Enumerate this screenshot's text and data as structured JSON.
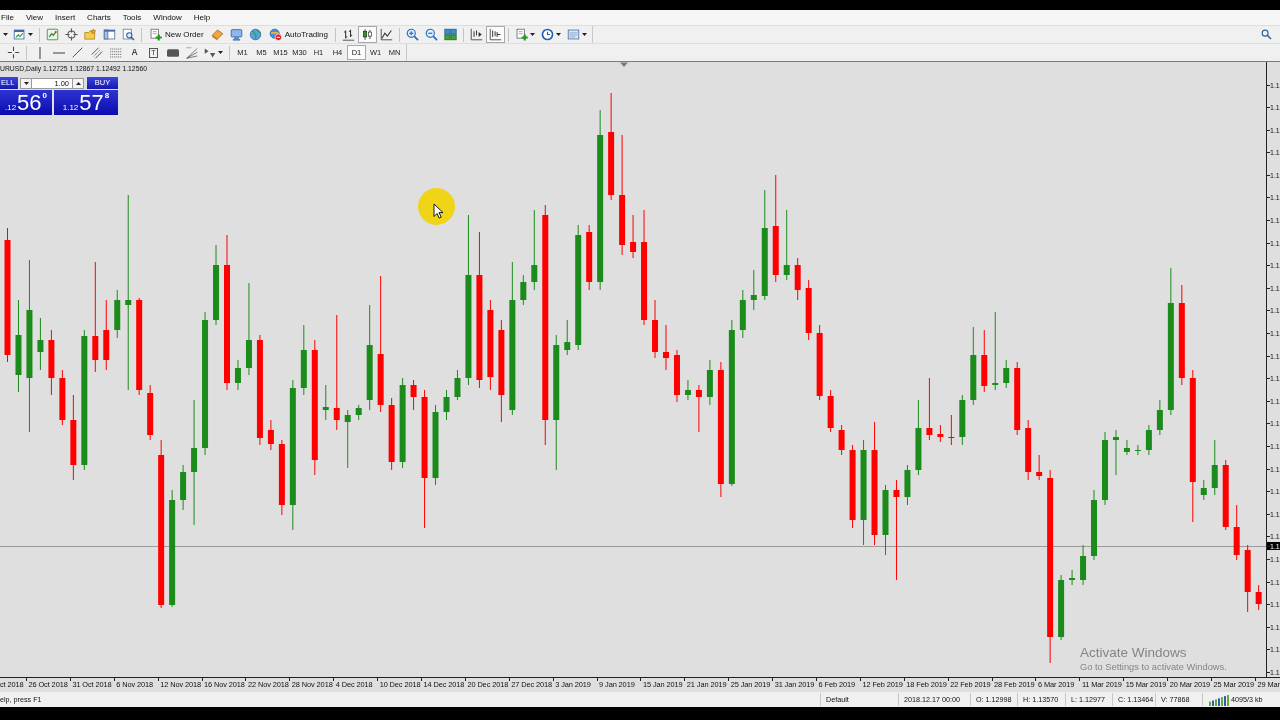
{
  "menu": [
    "File",
    "View",
    "Insert",
    "Charts",
    "Tools",
    "Window",
    "Help"
  ],
  "main_toolbar": [
    [
      {
        "pressed": false
      },
      {
        "pressed": false
      }
    ],
    [
      {
        "pressed": false
      },
      {
        "pressed": false
      },
      {
        "pressed": false
      },
      {
        "pressed": false
      },
      {
        "pressed": false
      }
    ],
    [
      {
        "label": "New Order",
        "pressed": false
      },
      {
        "pressed": false
      },
      {
        "pressed": false
      },
      {
        "pressed": false
      },
      {
        "label": "AutoTrading",
        "pressed": false
      }
    ],
    [
      {
        "pressed": false
      },
      {
        "pressed": true
      },
      {
        "pressed": false
      }
    ],
    [
      {
        "pressed": false
      },
      {
        "pressed": false
      },
      {
        "pressed": false
      }
    ],
    [
      {
        "pressed": false
      },
      {
        "pressed": true
      }
    ],
    [
      {
        "pressed": false
      },
      {
        "pressed": false
      },
      {
        "pressed": false
      }
    ]
  ],
  "drawing_toolbar": [
    [
      {
        "pressed": false
      }
    ],
    [
      {
        "pressed": false
      },
      {
        "pressed": false
      },
      {
        "pressed": false
      },
      {
        "pressed": false
      },
      {
        "pressed": false
      },
      {
        "label": "A",
        "pressed": false
      },
      {
        "label": "T",
        "pressed": false
      },
      {
        "pressed": false
      },
      {
        "pressed": false
      },
      {
        "pressed": false
      }
    ]
  ],
  "timeframes": [
    {
      "label": "M1",
      "selected": false
    },
    {
      "label": "M5",
      "selected": false
    },
    {
      "label": "M15",
      "selected": false
    },
    {
      "label": "M30",
      "selected": false
    },
    {
      "label": "H1",
      "selected": false
    },
    {
      "label": "H4",
      "selected": false
    },
    {
      "label": "D1",
      "selected": true
    },
    {
      "label": "W1",
      "selected": false
    },
    {
      "label": "MN",
      "selected": false
    }
  ],
  "chart": {
    "header": "URUSD,Daily 1.12725 1.12867 1.12492 1.12560",
    "one_click_trading": {
      "sell": {
        "label": "ELL",
        "price_prefix": ".12",
        "price_figure": "56",
        "price_pip": "0"
      },
      "lot": "1.00",
      "buy": {
        "label": "BUY",
        "price_prefix": "1.12",
        "price_figure": "57",
        "price_pip": "8"
      }
    },
    "price_axis": {
      "labels": [
        "1.1",
        "1.1",
        "1.1",
        "1.1",
        "1.1",
        "1.1",
        "1.1",
        "1.1",
        "1.1",
        "1.1",
        "1.1",
        "1.1",
        "1.1",
        "1.1",
        "1.1",
        "1.1",
        "1.1",
        "1.1",
        "1.1",
        "1.1",
        "1.1",
        "1.1",
        "1.1",
        "1.1",
        "1.1",
        "1.1",
        "1.1"
      ],
      "current": "1.1"
    },
    "date_axis": [
      "ct 2018",
      "26 Oct 2018",
      "31 Oct 2018",
      "6 Nov 2018",
      "12 Nov 2018",
      "16 Nov 2018",
      "22 Nov 2018",
      "28 Nov 2018",
      "4 Dec 2018",
      "10 Dec 2018",
      "14 Dec 2018",
      "20 Dec 2018",
      "27 Dec 2018",
      "3 Jan 2019",
      "9 Jan 2019",
      "15 Jan 2019",
      "21 Jan 2019",
      "25 Jan 2019",
      "31 Jan 2019",
      "6 Feb 2019",
      "12 Feb 2019",
      "18 Feb 2019",
      "22 Feb 2019",
      "28 Feb 2019",
      "6 Mar 2019",
      "11 Mar 2019",
      "15 Mar 2019",
      "20 Mar 2019",
      "25 Mar 2019",
      "29 Mar"
    ]
  },
  "os_notice": {
    "title": "Activate Windows",
    "subtitle": "Go to Settings to activate Windows."
  },
  "status_bar": {
    "help": "elp, press F1",
    "profile": "Default",
    "time": "2018.12.17 00:00",
    "open": "O: 1.12998",
    "high": "H: 1.13570",
    "low": "L: 1.12977",
    "close": "C: 1.13464",
    "volume": "V: 77868",
    "traffic": "4095/3 kb"
  }
}
